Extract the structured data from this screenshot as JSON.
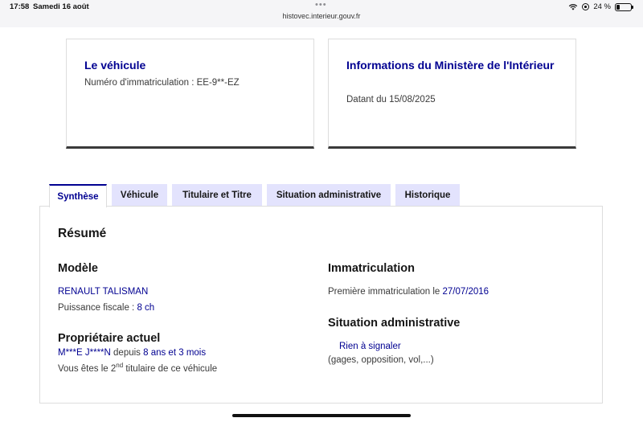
{
  "status_bar": {
    "time": "17:58",
    "date": "Samedi 16 août",
    "url": "histovec.interieur.gouv.fr",
    "battery": "24 %",
    "battery_level": 0.24
  },
  "cards": {
    "vehicle": {
      "title": "Le véhicule",
      "plate_text": "Numéro d'immatriculation : EE-9**-EZ"
    },
    "ministry": {
      "title": "Informations du Ministère de l'Intérieur",
      "date_text": "Datant du 15/08/2025"
    }
  },
  "tabs": [
    {
      "label": "Synthèse",
      "active": true
    },
    {
      "label": "Véhicule",
      "active": false
    },
    {
      "label": "Titulaire et Titre",
      "active": false
    },
    {
      "label": "Situation administrative",
      "active": false
    },
    {
      "label": "Historique",
      "active": false
    }
  ],
  "summary": {
    "title": "Résumé",
    "model": {
      "heading": "Modèle",
      "name": "RENAULT TALISMAN",
      "power_label": "Puissance fiscale : ",
      "power_value": "8 ch"
    },
    "owner": {
      "heading": "Propriétaire actuel",
      "name": "M***E J****N",
      "since_label": " depuis ",
      "duration": "8 ans et 3 mois",
      "rank_prefix": "Vous êtes le 2",
      "rank_sup": "nd",
      "rank_suffix": " titulaire de ce véhicule"
    },
    "registration": {
      "heading": "Immatriculation",
      "first_label": "Première immatriculation le ",
      "first_date": "27/07/2016"
    },
    "admin": {
      "heading": "Situation administrative",
      "status": "Rien à signaler",
      "details": "(gages, opposition, vol,...)"
    }
  }
}
